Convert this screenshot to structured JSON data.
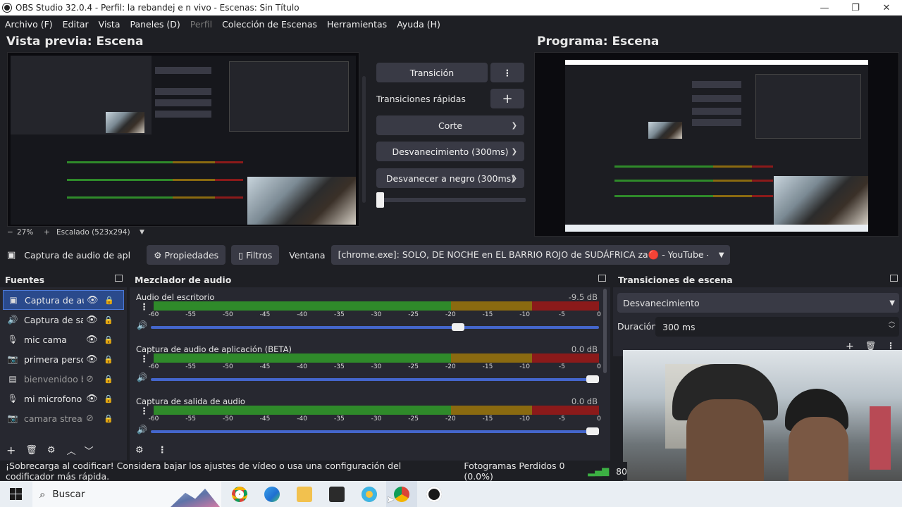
{
  "window": {
    "title": "OBS Studio 32.0.4 - Perfil: la rebandej e n  vivo - Escenas: Sin Título",
    "minimize": "—",
    "maximize": "❐",
    "close": "✕"
  },
  "menu": [
    {
      "label": "Archivo (F)",
      "disabled": false
    },
    {
      "label": "Editar",
      "disabled": false
    },
    {
      "label": "Vista",
      "disabled": false
    },
    {
      "label": "Paneles (D)",
      "disabled": false
    },
    {
      "label": "Perfil",
      "disabled": true
    },
    {
      "label": "Colección de Escenas",
      "disabled": false
    },
    {
      "label": "Herramientas",
      "disabled": false
    },
    {
      "label": "Ayuda (H)",
      "disabled": false
    }
  ],
  "preview": {
    "title": "Vista previa: Escena",
    "zoom": "27%",
    "scale_label": "Escalado (523x294)"
  },
  "program": {
    "title": "Programa: Escena"
  },
  "transition_panel": {
    "transition_button": "Transición",
    "quick_transitions": "Transiciones rápidas",
    "cut": "Corte",
    "fade": "Desvanecimiento (300ms)",
    "fade_black": "Desvanecer a negro (300ms)"
  },
  "source_toolbar": {
    "selected_source": "Captura de audio de aplicación",
    "properties": "Propiedades",
    "filters": "Filtros",
    "window_label": "Ventana",
    "window_value": "[chrome.exe]: SOLO, DE NOCHE en EL BARRIO ROJO de SUDÁFRICA za🔴 - YouTube - Google Chrome"
  },
  "sources": {
    "title": "Fuentes",
    "items": [
      {
        "label": "Captura de audio de aplicación",
        "icon": "app-audio-icon",
        "glyph": "▣",
        "visible": true,
        "selected": true
      },
      {
        "label": "Captura de salida de audio",
        "icon": "speaker-icon",
        "glyph": "🔊",
        "visible": true,
        "selected": false
      },
      {
        "label": "mic cama",
        "icon": "mic-icon",
        "glyph": "🎙",
        "visible": true,
        "selected": false
      },
      {
        "label": "primera persona",
        "icon": "camera-icon",
        "glyph": "📷",
        "visible": true,
        "selected": false
      },
      {
        "label": "bienvenidoo bg",
        "icon": "image-icon",
        "glyph": "▤",
        "visible": false,
        "selected": false
      },
      {
        "label": "mi microfono",
        "icon": "mic-icon",
        "glyph": "🎙",
        "visible": true,
        "selected": false
      },
      {
        "label": "camara streamer",
        "icon": "camera-icon",
        "glyph": "📷",
        "visible": false,
        "selected": false
      }
    ]
  },
  "mixer": {
    "title": "Mezclador de audio",
    "ticks": [
      "-60",
      "-55",
      "-50",
      "-45",
      "-40",
      "-35",
      "-30",
      "-25",
      "-20",
      "-15",
      "-10",
      "-5",
      "0"
    ],
    "channels": [
      {
        "name": "Audio del escritorio",
        "db": "-9.5 dB",
        "volume": 0.7
      },
      {
        "name": "Captura de audio de aplicación (BETA)",
        "db": "0.0 dB",
        "volume": 1.0
      },
      {
        "name": "Captura de salida de audio",
        "db": "0.0 dB",
        "volume": 1.0
      }
    ]
  },
  "scene_transitions": {
    "title": "Transiciones de escena",
    "selected": "Desvanecimiento",
    "duration_label": "Duración",
    "duration_value": "300 ms"
  },
  "status": {
    "warning": "¡Sobrecarga al codificar! Considera bajar los ajustes de vídeo o usa una configuración del codificador más rápida.",
    "dropped_frames": "Fotogramas Perdidos 0 (0.0%)",
    "bitrate": "80"
  },
  "taskbar": {
    "search_placeholder": "Buscar"
  },
  "colors": {
    "accent": "#4466cc",
    "meter_green": "#2f8a2a",
    "meter_yellow": "#8a6a10",
    "meter_red": "#8b1a1a",
    "selected_source": "#2a4a8c"
  }
}
